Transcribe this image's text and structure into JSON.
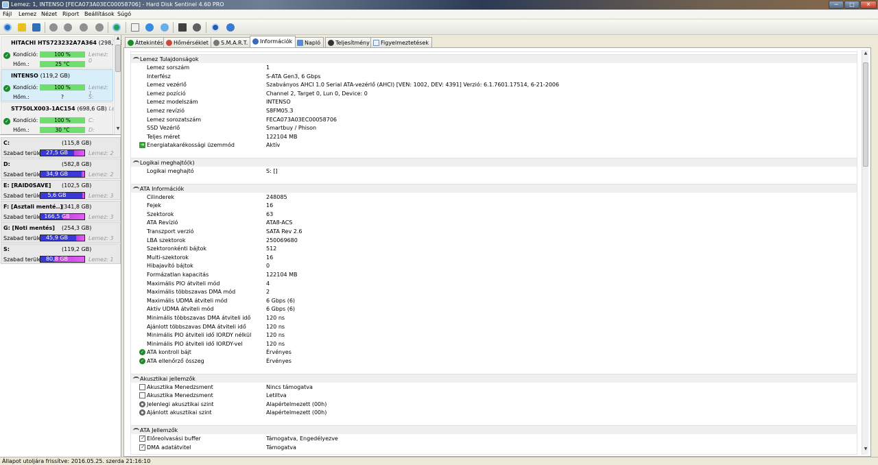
{
  "window": {
    "title": "Lemez: 1, INTENSO [FECA073A03EC00058706]  -  Hard Disk Sentinel 4.60 PRO",
    "minimize": "─",
    "maximize": "□",
    "close": "✕"
  },
  "menu": [
    "Fájl",
    "Lemez",
    "Nézet",
    "Riport",
    "Beállítások",
    "Súgó"
  ],
  "toolbar_icons": [
    "refresh-icon",
    "warning-icon",
    "report-icon",
    "disk-test-1-icon",
    "disk-test-2-icon",
    "disk-test-3-icon",
    "disk-test-4-icon",
    "globe-icon",
    "copy-icon",
    "sync-icon",
    "cloud-icon",
    "monitor-icon",
    "settings-icon",
    "help-icon",
    "info-icon"
  ],
  "disks": [
    {
      "name": "HITACHI HTS723232A7A364",
      "size": "(298,1 GB)",
      "disk_label": "Lemez: 0",
      "condition_label": "Kondíció:",
      "condition": "100 %",
      "temp_label": "Hőm.:",
      "temp": "25 °C",
      "drive": "",
      "selected": false
    },
    {
      "name": "INTENSO",
      "size": "(119,2 GB)",
      "disk_label": "Lemez: 1",
      "condition_label": "Kondíció:",
      "condition": "100 %",
      "temp_label": "Hőm.:",
      "temp": "?",
      "drive": "S:",
      "selected": true
    },
    {
      "name": "ST750LX003-1AC154",
      "size": "(698,6 GB)",
      "disk_label": "Lemez: 2",
      "condition_label": "Kondíció:",
      "condition": "100 %",
      "temp_label": "Hőm.:",
      "temp": "30 °C",
      "drive_top": "C:",
      "drive": "D:",
      "selected": false
    }
  ],
  "volumes": [
    {
      "name": "C:",
      "size": "(115,8 GB)",
      "free_label": "Szabad terület",
      "free": "27,5 GB",
      "used_fraction": 0.76,
      "disk": "Lemez: 2"
    },
    {
      "name": "D:",
      "size": "(582,8 GB)",
      "free_label": "Szabad terület",
      "free": "34,9 GB",
      "used_fraction": 0.94,
      "disk": "Lemez: 2"
    },
    {
      "name": "E: [RAID0SAVE]",
      "size": "(102,5 GB)",
      "free_label": "Szabad terület",
      "free": "5,6 GB",
      "used_fraction": 0.95,
      "disk": "Lemez: 3"
    },
    {
      "name": "F: [Asztali menté..]",
      "size": "(341,8 GB)",
      "free_label": "Szabad terület",
      "free": "166,5 GB",
      "used_fraction": 0.51,
      "disk": "Lemez: 3"
    },
    {
      "name": "G: [Noti mentés]",
      "size": "(254,3 GB)",
      "free_label": "Szabad terület",
      "free": "45,9 GB",
      "used_fraction": 0.82,
      "disk": "Lemez: 3"
    },
    {
      "name": "S:",
      "size": "(119,2 GB)",
      "free_label": "Szabad terület",
      "free": "80,8 GB",
      "used_fraction": 0.32,
      "disk": "Lemez: 1"
    }
  ],
  "tabs": [
    {
      "label": "Áttekintés",
      "icon": "check-icon",
      "active": false
    },
    {
      "label": "Hőmérséklet",
      "icon": "thermometer-icon",
      "active": false
    },
    {
      "label": "S.M.A.R.T.",
      "icon": "smart-icon",
      "active": false
    },
    {
      "label": "Információk",
      "icon": "info-icon",
      "active": true
    },
    {
      "label": "Napló",
      "icon": "log-icon",
      "active": false
    },
    {
      "label": "Teljesítmény",
      "icon": "performance-icon",
      "active": false
    },
    {
      "label": "Figyelmeztetések",
      "icon": "alerts-icon",
      "active": false
    }
  ],
  "sections": [
    {
      "title": "Lemez Tulajdonságok",
      "rows": [
        {
          "k": "Lemez sorszám",
          "v": "1"
        },
        {
          "k": "Interfész",
          "v": "S-ATA Gen3, 6 Gbps"
        },
        {
          "k": "Lemez vezérlő",
          "v": "Szabványos AHCI 1.0 Serial ATA-vezérlő (AHCI) [VEN: 1002, DEV: 4391] Verzió: 6.1.7601.17514, 6-21-2006"
        },
        {
          "k": "Lemez pozíció",
          "v": "Channel 2, Target 0, Lun 0, Device: 0"
        },
        {
          "k": "Lemez modelszám",
          "v": "INTENSO"
        },
        {
          "k": "Lemez revízió",
          "v": "S8FM05.3"
        },
        {
          "k": "Lemez sorozatszám",
          "v": "FECA073A03EC00058706"
        },
        {
          "k": "SSD Vezérlő",
          "v": "Smartbuy / Phison"
        },
        {
          "k": "Teljes méret",
          "v": "122104 MB"
        },
        {
          "k": "Energiatakarékossági üzemmód",
          "v": "Aktív",
          "icon": "arrow"
        }
      ]
    },
    {
      "title": "Logikai meghajtó(k)",
      "rows": [
        {
          "k": "Logikai meghajtó",
          "v": "S: []"
        }
      ]
    },
    {
      "title": "ATA Információk",
      "rows": [
        {
          "k": "Cilinderek",
          "v": "248085"
        },
        {
          "k": "Fejek",
          "v": "16"
        },
        {
          "k": "Szektorok",
          "v": "63"
        },
        {
          "k": "ATA Revízió",
          "v": "ATA8-ACS"
        },
        {
          "k": "Transzport verzió",
          "v": "SATA Rev 2.6"
        },
        {
          "k": "LBA szektorok",
          "v": "250069680"
        },
        {
          "k": "Szektoronkénti bájtok",
          "v": "512"
        },
        {
          "k": "Multi-szektorok",
          "v": "16"
        },
        {
          "k": "Hibajavító bájtok",
          "v": "0"
        },
        {
          "k": "Formázatlan kapacitás",
          "v": "122104 MB"
        },
        {
          "k": "Maximális PIO átviteli mód",
          "v": "4"
        },
        {
          "k": "Maximális többszavas DMA mód",
          "v": "2"
        },
        {
          "k": "Maximális UDMA átviteli mód",
          "v": "6 Gbps (6)"
        },
        {
          "k": "Aktív UDMA átviteli mód",
          "v": "6 Gbps (6)"
        },
        {
          "k": "Minimális többszavas DMA átviteli idő",
          "v": "120 ns"
        },
        {
          "k": "Ajánlott többszavas DMA átviteli idő",
          "v": "120 ns"
        },
        {
          "k": "Minimális PIO átviteli idő IORDY nélkül",
          "v": "120 ns"
        },
        {
          "k": "Minimális PIO átviteli idő IORDY-vel",
          "v": "120 ns"
        },
        {
          "k": "ATA kontroll bájt",
          "v": "Érvényes",
          "icon": "ok"
        },
        {
          "k": "ATA ellenőrző összeg",
          "v": "Érvényes",
          "icon": "ok"
        }
      ]
    },
    {
      "title": "Akusztikai jellemzők",
      "rows": [
        {
          "k": "Akusztika Menedzsment",
          "v": "Nincs támogatva",
          "icon": "chk"
        },
        {
          "k": "Akusztika Menedzsment",
          "v": "Letiltva",
          "icon": "chk"
        },
        {
          "k": "Jelenlegi akusztikai szint",
          "v": "Alapértelmezett (00h)",
          "icon": "gear"
        },
        {
          "k": "Ajánlott akusztikai szint",
          "v": "Alapértelmezett (00h)",
          "icon": "gear"
        }
      ]
    },
    {
      "title": "ATA Jellemzők",
      "rows": [
        {
          "k": "Előreolvasási buffer",
          "v": "Támogatva, Engedélyezve",
          "icon": "chkon"
        },
        {
          "k": "DMA adatátvitel",
          "v": "Támogatva",
          "icon": "chkon"
        }
      ]
    }
  ],
  "status": "Állapot utoljára frissítve: 2016.05.25. szerda 21:16:10"
}
